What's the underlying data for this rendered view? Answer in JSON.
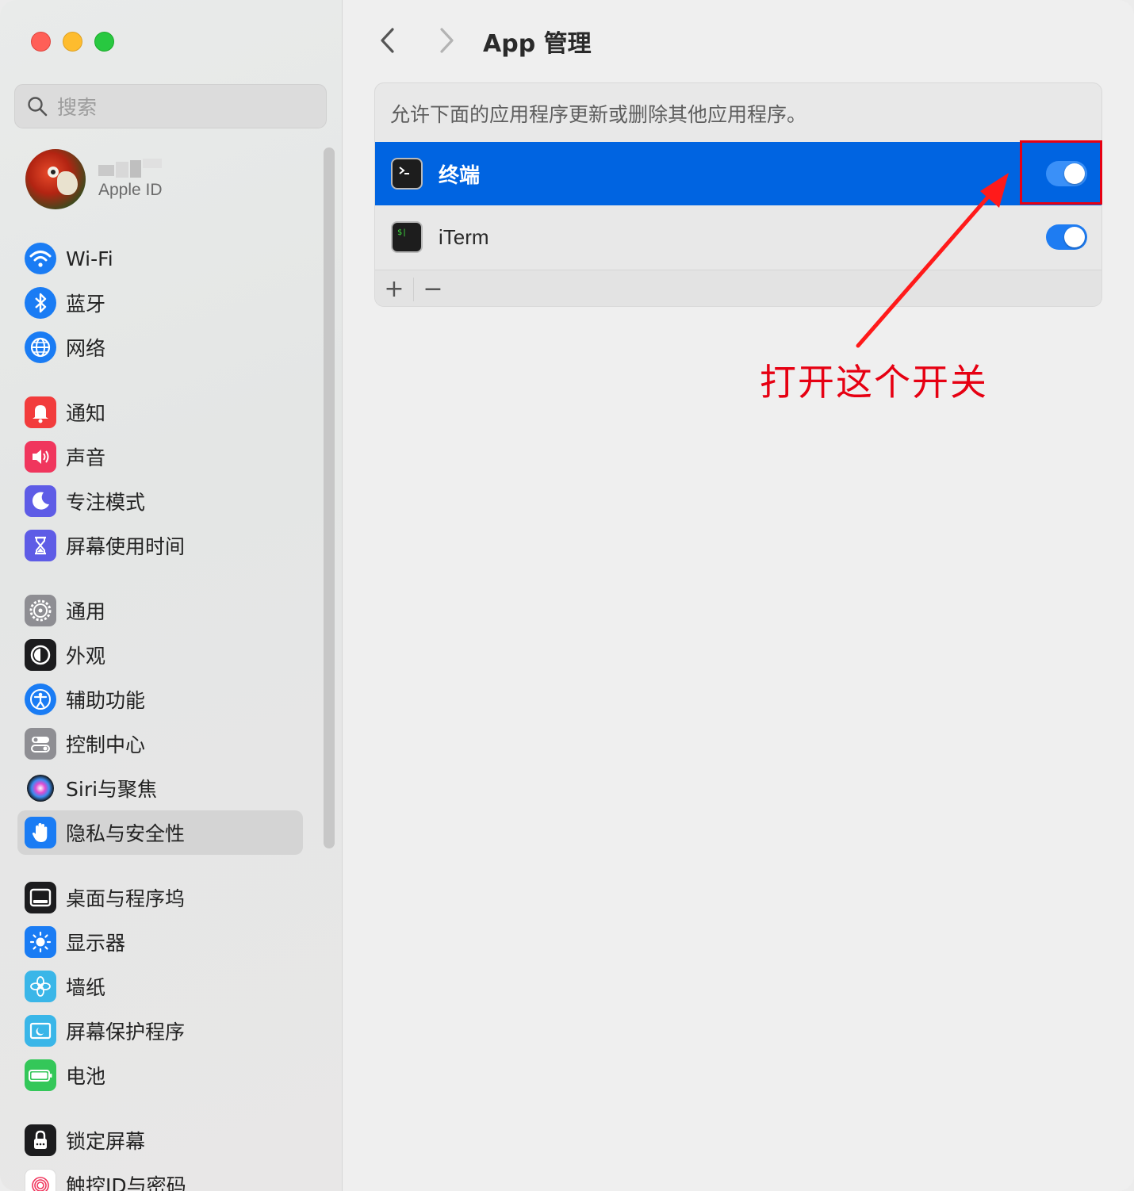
{
  "sidebar": {
    "search_placeholder": "搜索",
    "profile": {
      "subtitle": "Apple ID"
    },
    "groups": [
      [
        {
          "label": "Wi-Fi",
          "icon": "wifi-icon",
          "color": "#1a7cf4"
        },
        {
          "label": "蓝牙",
          "icon": "bluetooth-icon",
          "color": "#1a7cf4"
        },
        {
          "label": "网络",
          "icon": "globe-icon",
          "color": "#1a7cf4"
        }
      ],
      [
        {
          "label": "通知",
          "icon": "bell-icon",
          "color": "#f23c3c"
        },
        {
          "label": "声音",
          "icon": "speaker-icon",
          "color": "#f0365d"
        },
        {
          "label": "专注模式",
          "icon": "moon-icon",
          "color": "#5e5ce6"
        },
        {
          "label": "屏幕使用时间",
          "icon": "hourglass-icon",
          "color": "#5e5ce6"
        }
      ],
      [
        {
          "label": "通用",
          "icon": "gear-icon",
          "color": "#8e8e93"
        },
        {
          "label": "外观",
          "icon": "appearance-icon",
          "color": "#1c1c1e"
        },
        {
          "label": "辅助功能",
          "icon": "accessibility-icon",
          "color": "#1a7cf4"
        },
        {
          "label": "控制中心",
          "icon": "control-center-icon",
          "color": "#8e8e93"
        },
        {
          "label": "Siri与聚焦",
          "icon": "siri-icon",
          "color": "#2a2a3a"
        },
        {
          "label": "隐私与安全性",
          "icon": "hand-icon",
          "color": "#1a7cf4",
          "selected": true
        }
      ],
      [
        {
          "label": "桌面与程序坞",
          "icon": "dock-icon",
          "color": "#1c1c1e"
        },
        {
          "label": "显示器",
          "icon": "sun-icon",
          "color": "#1a7cf4"
        },
        {
          "label": "墙纸",
          "icon": "flower-icon",
          "color": "#3ab6e8"
        },
        {
          "label": "屏幕保护程序",
          "icon": "screensaver-icon",
          "color": "#3ab6e8"
        },
        {
          "label": "电池",
          "icon": "battery-icon",
          "color": "#34c759"
        }
      ],
      [
        {
          "label": "锁定屏幕",
          "icon": "lock-icon",
          "color": "#1c1c1e"
        },
        {
          "label": "触控ID与密码",
          "icon": "fingerprint-icon",
          "color": "#f0365d"
        }
      ]
    ]
  },
  "main": {
    "title": "App 管理",
    "description": "允许下面的应用程序更新或删除其他应用程序。",
    "apps": [
      {
        "name": "终端",
        "enabled": true,
        "selected": true
      },
      {
        "name": "iTerm",
        "enabled": true,
        "selected": false
      }
    ],
    "add_label": "+",
    "remove_label": "−"
  },
  "annotation": {
    "text": "打开这个开关",
    "color": "#e60012"
  }
}
